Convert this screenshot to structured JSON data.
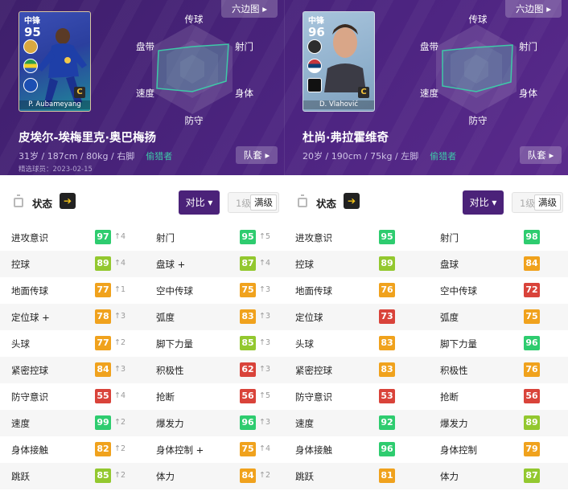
{
  "colors": {
    "green": "#2ecc6f",
    "lime": "#93c82f",
    "orange": "#f0a21d",
    "red": "#d9433a"
  },
  "players": [
    {
      "card": {
        "position": "中锋",
        "rating": "95",
        "name": "P. Aubameyang",
        "playstyle": "C"
      },
      "radar_labels": {
        "top": "传球",
        "upper_right": "射门",
        "lower_right": "身体",
        "bottom": "防守",
        "lower_left": "速度",
        "upper_left": "盘带"
      },
      "hex_button": "六边图",
      "full_name": "皮埃尔-埃梅里克·奥巴梅扬",
      "info": "31岁 / 187cm / 80kg / 右脚",
      "role": "偷猎者",
      "date": "精选球员：2023-02-15",
      "team_button": "队套"
    },
    {
      "card": {
        "position": "中锋",
        "rating": "96",
        "name": "D. Vlahović",
        "playstyle": "C"
      },
      "radar_labels": {
        "top": "传球",
        "upper_right": "射门",
        "lower_right": "身体",
        "bottom": "防守",
        "lower_left": "速度",
        "upper_left": "盘带"
      },
      "hex_button": "六边图",
      "full_name": "杜尚·弗拉霍维奇",
      "info": "20岁 / 190cm / 75kg / 左脚",
      "role": "偷猎者",
      "date": "",
      "team_button": "队套"
    }
  ],
  "stats_bar": {
    "title": "状态",
    "compare": "对比",
    "level1": "1级",
    "level_max": "满级"
  },
  "left_stats": [
    [
      {
        "n": "进攻意识",
        "v": "97",
        "c": "green",
        "t": "↑4"
      },
      {
        "n": "射门",
        "v": "95",
        "c": "green",
        "t": "↑5"
      }
    ],
    [
      {
        "n": "控球",
        "v": "89",
        "c": "lime",
        "t": "↑4"
      },
      {
        "n": "盘球 +",
        "v": "87",
        "c": "lime",
        "t": "↑4"
      }
    ],
    [
      {
        "n": "地面传球",
        "v": "77",
        "c": "orange",
        "t": "↑1"
      },
      {
        "n": "空中传球",
        "v": "75",
        "c": "orange",
        "t": "↑3"
      }
    ],
    [
      {
        "n": "定位球 +",
        "v": "78",
        "c": "orange",
        "t": "↑3"
      },
      {
        "n": "弧度",
        "v": "83",
        "c": "orange",
        "t": "↑3"
      }
    ],
    [
      {
        "n": "头球",
        "v": "77",
        "c": "orange",
        "t": "↑2"
      },
      {
        "n": "脚下力量",
        "v": "85",
        "c": "lime",
        "t": "↑3"
      }
    ],
    [
      {
        "n": "紧密控球",
        "v": "84",
        "c": "orange",
        "t": "↑3"
      },
      {
        "n": "积极性",
        "v": "62",
        "c": "red",
        "t": "↑3"
      }
    ],
    [
      {
        "n": "防守意识",
        "v": "55",
        "c": "red",
        "t": "↑4"
      },
      {
        "n": "抢断",
        "v": "56",
        "c": "red",
        "t": "↑5"
      }
    ],
    [
      {
        "n": "速度",
        "v": "99",
        "c": "green",
        "t": "↑2"
      },
      {
        "n": "爆发力",
        "v": "96",
        "c": "green",
        "t": "↑3"
      }
    ],
    [
      {
        "n": "身体接触",
        "v": "82",
        "c": "orange",
        "t": "↑2"
      },
      {
        "n": "身体控制 +",
        "v": "75",
        "c": "orange",
        "t": "↑4"
      }
    ],
    [
      {
        "n": "跳跃",
        "v": "85",
        "c": "lime",
        "t": "↑2"
      },
      {
        "n": "体力",
        "v": "84",
        "c": "orange",
        "t": "↑2"
      }
    ]
  ],
  "right_stats": [
    [
      {
        "n": "进攻意识",
        "v": "95",
        "c": "green",
        "t": ""
      },
      {
        "n": "射门",
        "v": "98",
        "c": "green",
        "t": ""
      }
    ],
    [
      {
        "n": "控球",
        "v": "89",
        "c": "lime",
        "t": ""
      },
      {
        "n": "盘球",
        "v": "84",
        "c": "orange",
        "t": ""
      }
    ],
    [
      {
        "n": "地面传球",
        "v": "76",
        "c": "orange",
        "t": ""
      },
      {
        "n": "空中传球",
        "v": "72",
        "c": "red",
        "t": ""
      }
    ],
    [
      {
        "n": "定位球",
        "v": "73",
        "c": "red",
        "t": ""
      },
      {
        "n": "弧度",
        "v": "75",
        "c": "orange",
        "t": ""
      }
    ],
    [
      {
        "n": "头球",
        "v": "83",
        "c": "orange",
        "t": ""
      },
      {
        "n": "脚下力量",
        "v": "96",
        "c": "green",
        "t": ""
      }
    ],
    [
      {
        "n": "紧密控球",
        "v": "83",
        "c": "orange",
        "t": ""
      },
      {
        "n": "积极性",
        "v": "76",
        "c": "orange",
        "t": ""
      }
    ],
    [
      {
        "n": "防守意识",
        "v": "53",
        "c": "red",
        "t": ""
      },
      {
        "n": "抢断",
        "v": "56",
        "c": "red",
        "t": ""
      }
    ],
    [
      {
        "n": "速度",
        "v": "92",
        "c": "green",
        "t": ""
      },
      {
        "n": "爆发力",
        "v": "89",
        "c": "lime",
        "t": ""
      }
    ],
    [
      {
        "n": "身体接触",
        "v": "96",
        "c": "green",
        "t": ""
      },
      {
        "n": "身体控制",
        "v": "79",
        "c": "orange",
        "t": ""
      }
    ],
    [
      {
        "n": "跳跃",
        "v": "81",
        "c": "orange",
        "t": ""
      },
      {
        "n": "体力",
        "v": "87",
        "c": "lime",
        "t": ""
      }
    ]
  ]
}
